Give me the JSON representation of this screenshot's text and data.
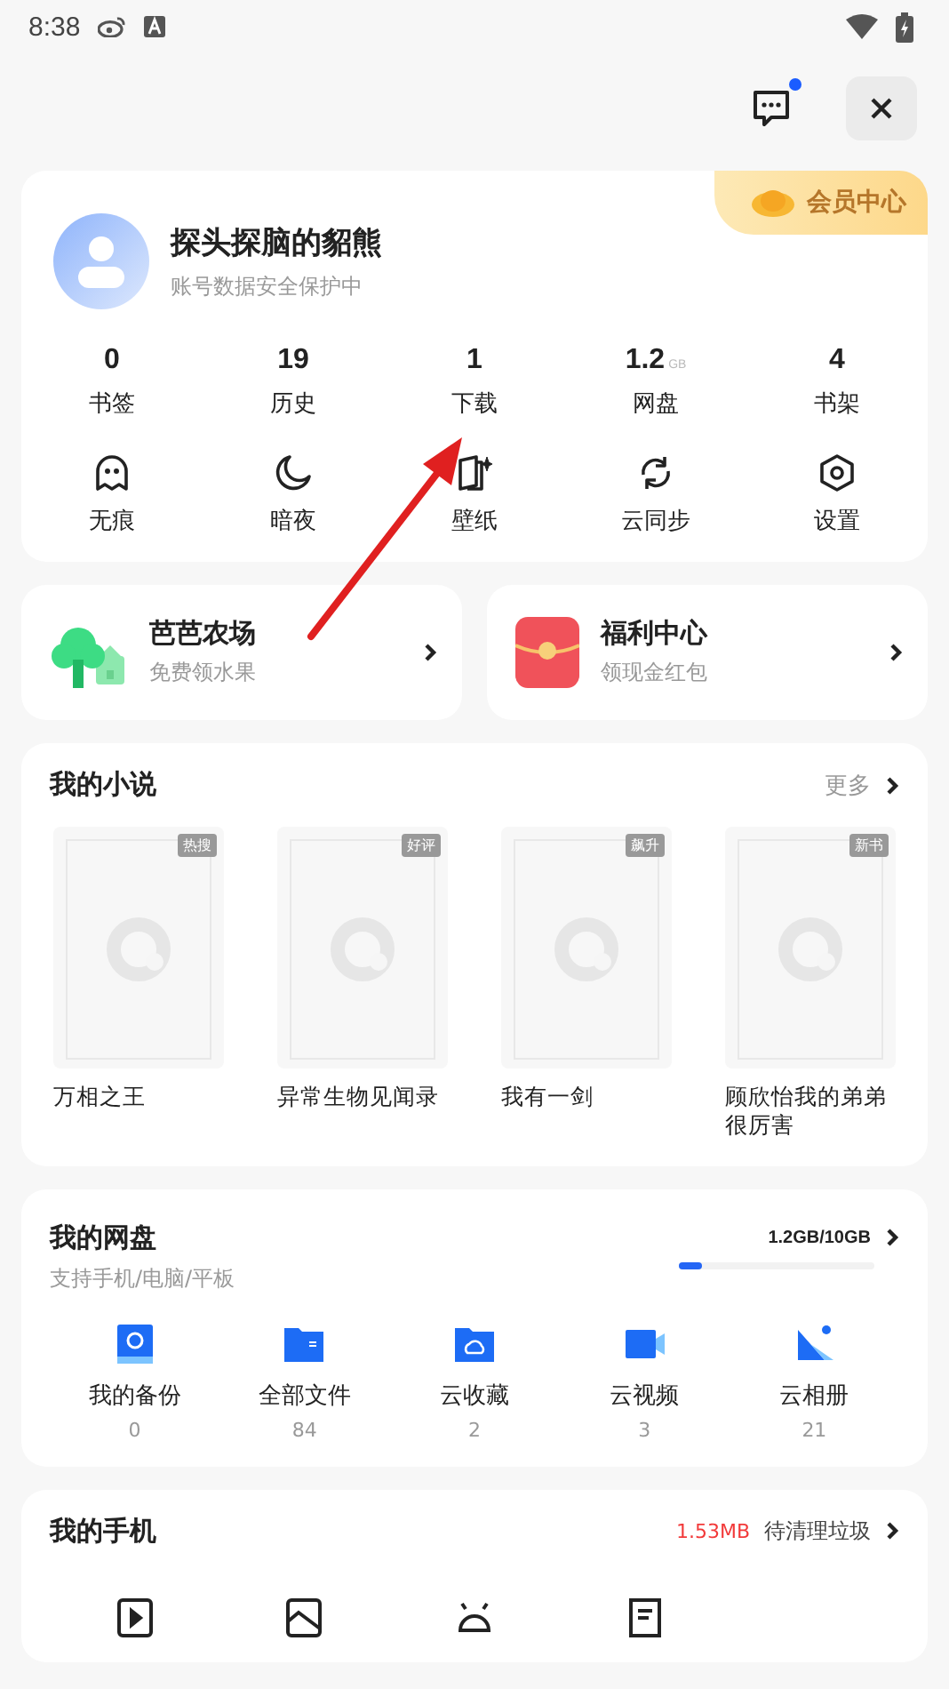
{
  "status_bar": {
    "time": "8:38"
  },
  "header": {
    "unread": true
  },
  "profile": {
    "name": "探头探脑的貂熊",
    "subtitle": "账号数据安全保护中",
    "vip_label": "会员中心"
  },
  "stats": [
    {
      "value": "0",
      "label": "书签"
    },
    {
      "value": "19",
      "label": "历史"
    },
    {
      "value": "1",
      "label": "下载"
    },
    {
      "value": "1.2",
      "unit": "GB",
      "label": "网盘"
    },
    {
      "value": "4",
      "label": "书架"
    }
  ],
  "tools": [
    {
      "label": "无痕",
      "kind": "ghost"
    },
    {
      "label": "暗夜",
      "kind": "moon"
    },
    {
      "label": "壁纸",
      "kind": "wallpaper"
    },
    {
      "label": "云同步",
      "kind": "sync"
    },
    {
      "label": "设置",
      "kind": "settings"
    }
  ],
  "promos": [
    {
      "title": "芭芭农场",
      "subtitle": "免费领水果",
      "kind": "farm"
    },
    {
      "title": "福利中心",
      "subtitle": "领现金红包",
      "kind": "redpacket"
    }
  ],
  "novels": {
    "title": "我的小说",
    "more": "更多",
    "books": [
      {
        "title": "万相之王",
        "tag": "热搜"
      },
      {
        "title": "异常生物见闻录",
        "tag": "好评"
      },
      {
        "title": "我有一剑",
        "tag": "飙升"
      },
      {
        "title": "顾欣怡我的弟弟很厉害",
        "tag": "新书"
      }
    ]
  },
  "cloud": {
    "title": "我的网盘",
    "subtitle": "支持手机/电脑/平板",
    "usage": "1.2GB/10GB",
    "level": 0.12,
    "items": [
      {
        "label": "我的备份",
        "count": "0",
        "kind": "backup"
      },
      {
        "label": "全部文件",
        "count": "84",
        "kind": "files"
      },
      {
        "label": "云收藏",
        "count": "2",
        "kind": "favorites"
      },
      {
        "label": "云视频",
        "count": "3",
        "kind": "video"
      },
      {
        "label": "云相册",
        "count": "21",
        "kind": "photos"
      }
    ]
  },
  "phone": {
    "title": "我的手机",
    "size": "1.53MB",
    "size_label": "待清理垃圾",
    "items": [
      {
        "kind": "video"
      },
      {
        "kind": "image"
      },
      {
        "kind": "apk"
      },
      {
        "kind": "document"
      }
    ]
  }
}
